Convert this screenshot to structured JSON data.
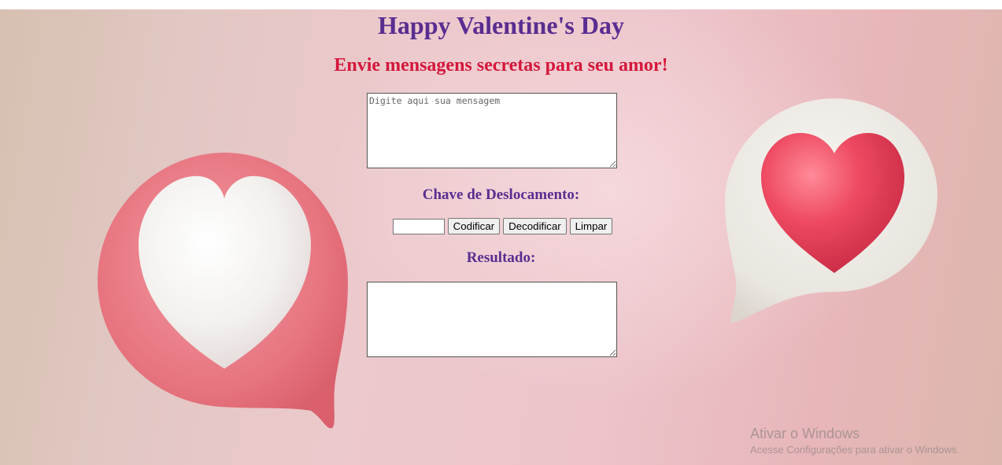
{
  "page": {
    "title": "Happy Valentine's Day",
    "subtitle": "Envie mensagens secretas para seu amor!"
  },
  "message_input": {
    "placeholder": "Digite aqui sua mensagem",
    "value": ""
  },
  "shift_key": {
    "label": "Chave de Deslocamento:",
    "value": ""
  },
  "buttons": {
    "encode": "Codificar",
    "decode": "Decodificar",
    "clear": "Limpar"
  },
  "result": {
    "label": "Resultado:",
    "value": ""
  },
  "watermark": {
    "title": "Ativar o Windows",
    "subtitle": "Acesse Configurações para ativar o Windows."
  },
  "decorations": {
    "left_bubble": "pink-speech-bubble-with-white-heart-icon",
    "right_bubble": "white-speech-bubble-with-red-heart-icon"
  },
  "colors": {
    "title": "#5a2d91",
    "subtitle": "#d4173b",
    "background": "#ecc9cc"
  }
}
